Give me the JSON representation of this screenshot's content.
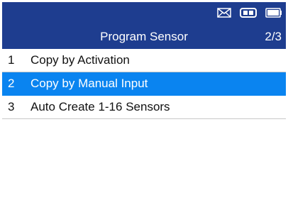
{
  "status_bar": {
    "icons": [
      "mail-icon",
      "vci-connection-icon",
      "battery-icon"
    ]
  },
  "header": {
    "title": "Program Sensor",
    "page_indicator": "2/3"
  },
  "menu": {
    "items": [
      {
        "number": "1",
        "label": "Copy by Activation",
        "selected": false
      },
      {
        "number": "2",
        "label": "Copy by Manual Input",
        "selected": true
      },
      {
        "number": "3",
        "label": "Auto Create 1-16 Sensors",
        "selected": false
      }
    ]
  },
  "colors": {
    "header_background": "#1e3d8f",
    "selection_highlight": "#0a84f0",
    "text": "#111111",
    "divider": "#c8c8c8"
  }
}
